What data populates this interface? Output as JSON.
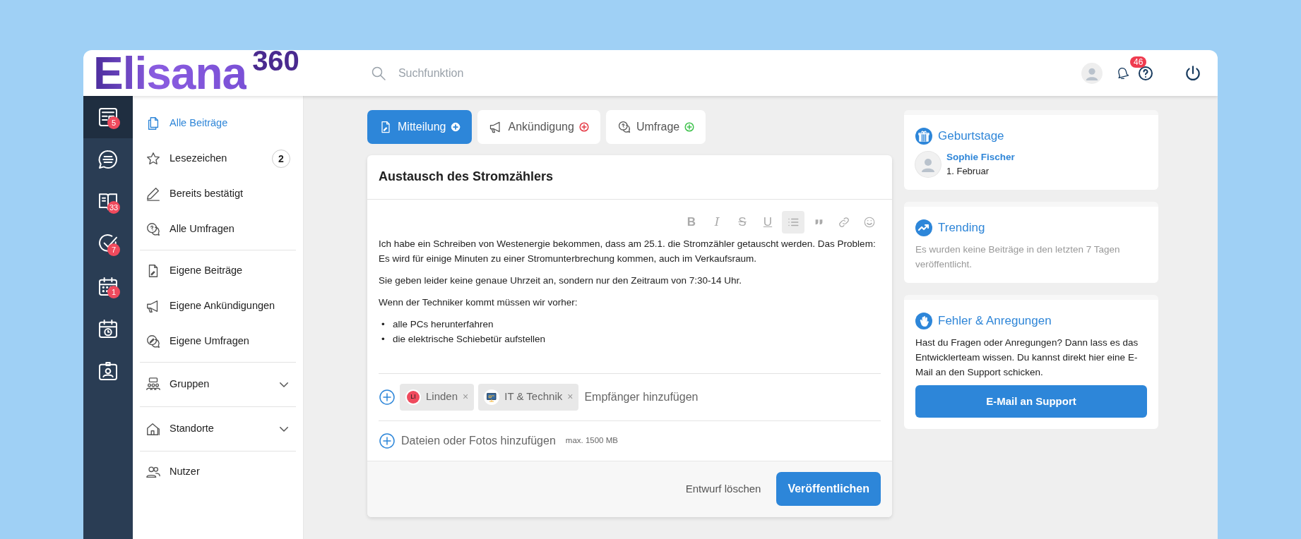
{
  "header": {
    "logo": {
      "name": "Elisana",
      "superscript": "360"
    },
    "search": {
      "placeholder": "Suchfunktion"
    },
    "notifications_badge": "46"
  },
  "rail": [
    {
      "kind": "news",
      "badge": "5",
      "selected": true
    },
    {
      "kind": "chat",
      "selected": false
    },
    {
      "kind": "book",
      "badge": "33",
      "selected": false
    },
    {
      "kind": "tasks",
      "badge": "7",
      "selected": false
    },
    {
      "kind": "calendar",
      "badge": "1",
      "selected": false
    },
    {
      "kind": "schedule",
      "selected": false
    },
    {
      "kind": "contact",
      "selected": false
    }
  ],
  "sidebar": {
    "groups": [
      [
        {
          "label": "Alle Beiträge",
          "kind": "copies",
          "selected": true
        },
        {
          "label": "Lesezeichen",
          "kind": "star",
          "selected": false,
          "count": "2"
        },
        {
          "label": "Bereits bestätigt",
          "kind": "pencil",
          "selected": false
        },
        {
          "label": "Alle Umfragen",
          "kind": "poll",
          "selected": false
        }
      ],
      [
        {
          "label": "Eigene Beiträge",
          "kind": "doc",
          "selected": false
        },
        {
          "label": "Eigene Ankündigungen",
          "kind": "megaphone",
          "selected": false
        },
        {
          "label": "Eigene Umfragen",
          "kind": "pollpen",
          "selected": false
        }
      ],
      [
        {
          "label": "Gruppen",
          "kind": "groups",
          "selected": false,
          "expanded": false
        }
      ],
      [
        {
          "label": "Standorte",
          "kind": "house",
          "selected": false,
          "expanded": false
        }
      ],
      [
        {
          "label": "Nutzer",
          "kind": "users",
          "selected": false
        }
      ]
    ]
  },
  "composer": {
    "tabs": [
      {
        "label": "Mitteilung",
        "kind": "doc",
        "selected": true,
        "color": "#ffffff"
      },
      {
        "label": "Ankündigung",
        "kind": "megaphone",
        "selected": false,
        "color": "#e53945"
      },
      {
        "label": "Umfrage",
        "kind": "poll",
        "selected": false,
        "color": "#3ec24c"
      }
    ],
    "title": "Austausch des Stromzählers",
    "toolbar": [
      {
        "kind": "bold",
        "glyph": "B",
        "active": false
      },
      {
        "kind": "italic",
        "glyph": "I",
        "active": false
      },
      {
        "kind": "strike",
        "glyph": "S",
        "active": false
      },
      {
        "kind": "underline",
        "glyph": "U",
        "active": false
      },
      {
        "kind": "list",
        "active": true
      },
      {
        "kind": "quote",
        "active": false
      },
      {
        "kind": "link",
        "active": false
      },
      {
        "kind": "emoji",
        "active": false
      }
    ],
    "paragraphs": [
      "Ich habe ein Schreiben von Westenergie bekommen, dass am 25.1. die Stromzähler getauscht werden. Das Problem: Es wird für einige Minuten zu einer Stromunterbrechung kommen, auch im Verkaufsraum.",
      "Sie geben leider keine genaue Uhrzeit an, sondern nur den Zeitraum von 7:30-14 Uhr.",
      "Wenn der Techniker kommt müssen wir vorher:"
    ],
    "bullets": [
      {
        "marker": "•",
        "text": "alle PCs herunterfahren"
      },
      {
        "marker": "•",
        "text": "die elektrische Schiebetür aufstellen"
      }
    ],
    "recipients": [
      {
        "label": "Linden",
        "kind": "initials",
        "initials": "LI",
        "remove": "×"
      },
      {
        "label": "IT & Technik",
        "kind": "group",
        "remove": "×"
      }
    ],
    "recipients_placeholder": "Empfänger hinzufügen",
    "attachments": {
      "label": "Dateien oder Fotos hinzufügen",
      "limit": "max. 1500 MB"
    },
    "actions": {
      "discard": "Entwurf löschen",
      "publish": "Veröffentlichen"
    }
  },
  "widgets": [
    {
      "kind": "birthdays",
      "title": "Geburtstage",
      "people": [
        {
          "name": "Sophie Fischer",
          "date": "1. Februar"
        }
      ]
    },
    {
      "kind": "trending",
      "title": "Trending",
      "text": "Es wurden keine Beiträge in den letzten 7 Tagen veröffentlicht."
    },
    {
      "kind": "feedback",
      "title": "Fehler & Anregungen",
      "text": "Hast du Fragen oder Anregungen? Dann lass es das Entwicklerteam wissen. Du kannst direkt hier eine E-Mail an den Support schicken.",
      "button": "E-Mail an Support"
    }
  ]
}
